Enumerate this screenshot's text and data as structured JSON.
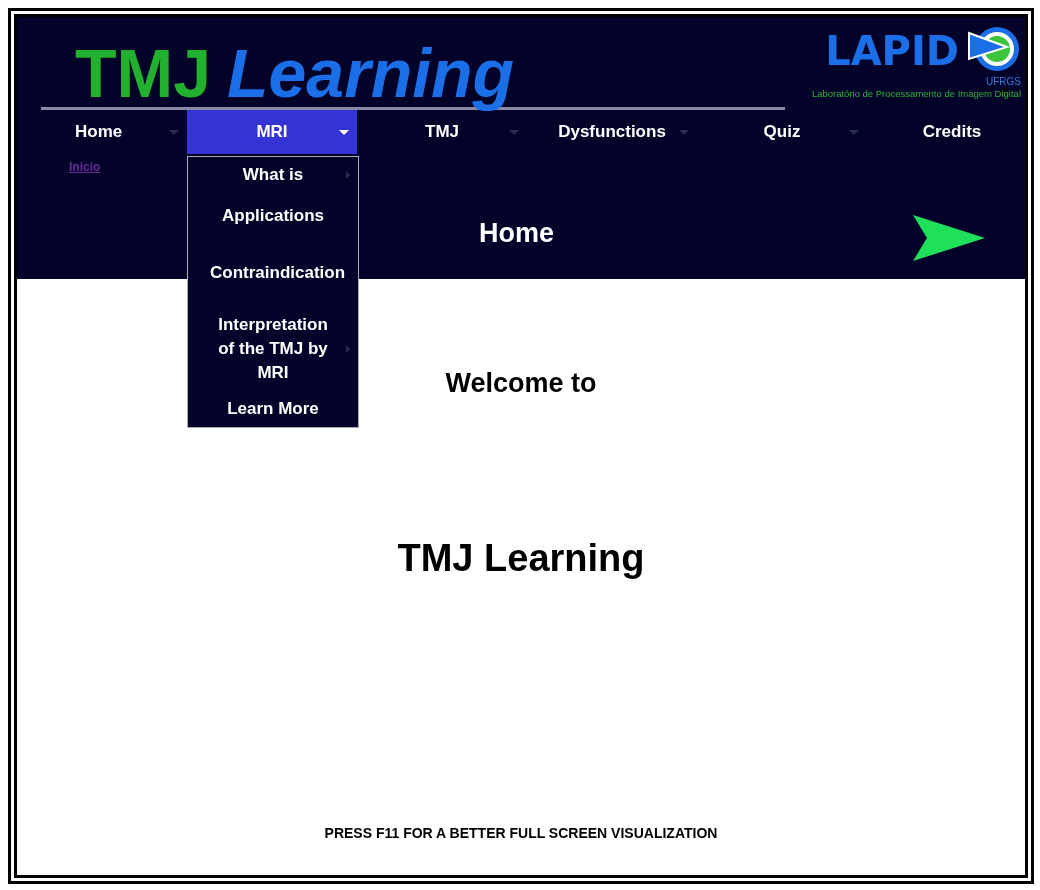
{
  "header": {
    "title_part_1": "TMJ",
    "title_part_2": "Learning",
    "logo": {
      "name": "LAPID",
      "university": "UFRGS",
      "subtitle": "Laboratório de Processamento de Imagem Digital"
    }
  },
  "nav": [
    {
      "label": "Home",
      "has_menu": true,
      "selected": false
    },
    {
      "label": "MRI",
      "has_menu": true,
      "selected": true
    },
    {
      "label": "TMJ",
      "has_menu": true,
      "selected": false
    },
    {
      "label": "Dysfunctions",
      "has_menu": true,
      "selected": false
    },
    {
      "label": "Quiz",
      "has_menu": true,
      "selected": false
    },
    {
      "label": "Credits",
      "has_menu": false,
      "selected": false
    }
  ],
  "dropdown": {
    "items": [
      {
        "label": "What is",
        "has_submenu": true
      },
      {
        "label": "Applications",
        "has_submenu": false
      },
      {
        "label": "Contraindication",
        "has_submenu": false
      },
      {
        "label": "Interpretation of the TMJ by MRI",
        "has_submenu": true
      },
      {
        "label": "Learn More",
        "has_submenu": false
      }
    ]
  },
  "breadcrumb": "Inicio",
  "page_title": "Home",
  "content": {
    "welcome": "Welcome to",
    "heading": "TMJ Learning",
    "note": "PRESS F11 FOR A BETTER FULL SCREEN VISUALIZATION"
  }
}
